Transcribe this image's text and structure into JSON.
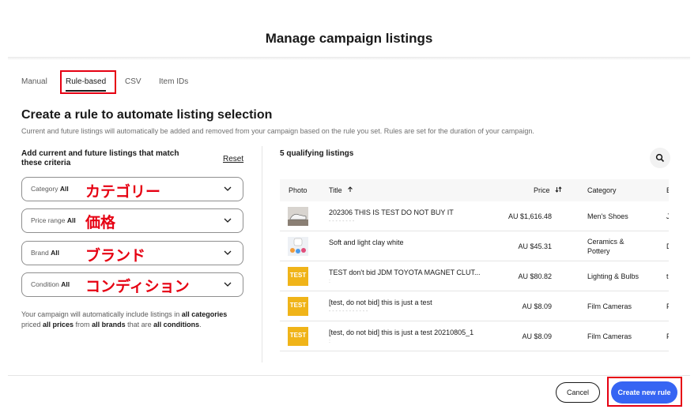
{
  "modal": {
    "title": "Manage campaign listings"
  },
  "tabs": [
    {
      "label": "Manual",
      "active": false
    },
    {
      "label": "Rule-based",
      "active": true
    },
    {
      "label": "CSV",
      "active": false
    },
    {
      "label": "Item IDs",
      "active": false
    }
  ],
  "rule": {
    "heading": "Create a rule to automate listing selection",
    "subtitle": "Current and future listings will automatically be added and removed from your campaign based on the rule you set. Rules are set for the duration of your campaign.",
    "criteria_title": "Add current and future listings that match these criteria",
    "reset_label": "Reset",
    "filters": [
      {
        "label": "Category",
        "value": "All",
        "annotation": "カテゴリー"
      },
      {
        "label": "Price range",
        "value": "All",
        "annotation": "価格"
      },
      {
        "label": "Brand",
        "value": "All",
        "annotation": "ブランド"
      },
      {
        "label": "Condition",
        "value": "All",
        "annotation": "コンディション"
      }
    ],
    "summary": {
      "t1": "Your campaign will automatically include listings in ",
      "b1": "all categories",
      "t2": " priced ",
      "b2": "all prices",
      "t3": " from ",
      "b3": "all brands",
      "t4": " that are ",
      "b4": "all conditions",
      "t5": "."
    }
  },
  "listings": {
    "count_label": "5 qualifying listings",
    "columns": {
      "photo": "Photo",
      "title": "Title",
      "price": "Price",
      "category": "Category",
      "extra": "B"
    },
    "rows": [
      {
        "title": "202306 THIS IS TEST DO NOT BUY IT",
        "sub": "- - - - - - - -",
        "price": "AU $1,616.48",
        "category": "Men's Shoes",
        "category2": "",
        "extra": "J",
        "photo": "shoe"
      },
      {
        "title": "Soft and light clay white",
        "sub": "",
        "price": "AU $45.31",
        "category": "Ceramics &",
        "category2": "Pottery",
        "extra": "D",
        "photo": "clay"
      },
      {
        "title": "TEST don't bid JDM TOYOTA MAGNET CLUT...",
        "sub": ":",
        "price": "AU $80.82",
        "category": "Lighting & Bulbs",
        "category2": "",
        "extra": "t",
        "photo": "test"
      },
      {
        "title": "[test, do not bid] this is just a test",
        "sub": "- - - - - - - - - - - -",
        "price": "AU $8.09",
        "category": "Film Cameras",
        "category2": "",
        "extra": "F",
        "photo": "test"
      },
      {
        "title": "[test, do not bid] this is just a test 20210805_1",
        "sub": ":",
        "price": "AU $8.09",
        "category": "Film Cameras",
        "category2": "",
        "extra": "F",
        "photo": "test"
      }
    ]
  },
  "footer": {
    "cancel_label": "Cancel",
    "create_label": "Create new rule"
  },
  "colors": {
    "primary": "#3665f3",
    "annotation_red": "#e60012",
    "test_logo": "#f0b419"
  },
  "icons": [
    "chevron-down-icon",
    "search-icon",
    "sort-up-icon",
    "sort-updown-icon"
  ]
}
